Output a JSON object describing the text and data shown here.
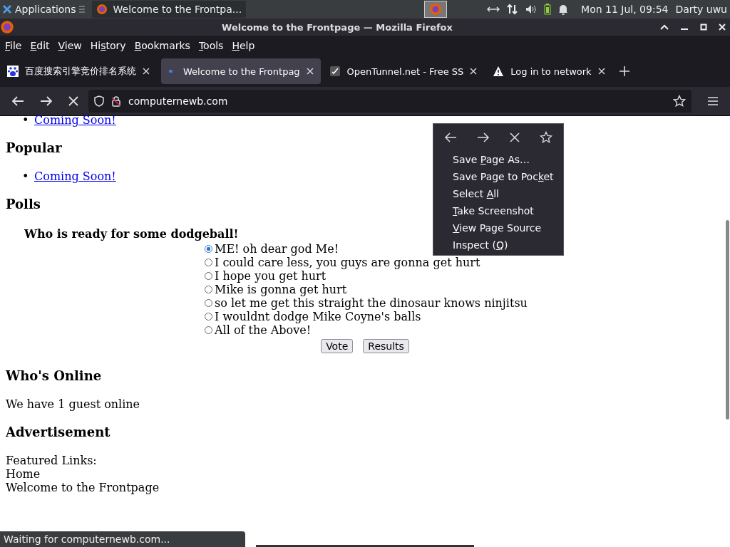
{
  "taskbar": {
    "apps_label": "Applications",
    "task": "Welcome to the Frontpa...",
    "clock": "Mon 11 Jul, 09:54",
    "user": "Darty uwu"
  },
  "window": {
    "title": "Welcome to the Frontpage — Mozilla Firefox"
  },
  "menubar": [
    {
      "key": "F",
      "after": "ile"
    },
    {
      "key": "E",
      "after": "dit"
    },
    {
      "key": "V",
      "after": "iew"
    },
    {
      "before": "Hi",
      "key": "s",
      "after": "tory"
    },
    {
      "key": "B",
      "after": "ookmarks"
    },
    {
      "key": "T",
      "after": "ools"
    },
    {
      "key": "H",
      "after": "elp"
    }
  ],
  "tabs": [
    {
      "title": "百度搜索引擎竞价排名系统",
      "kind": "paw",
      "selected": false
    },
    {
      "title": "Welcome to the Frontpag",
      "kind": "dot",
      "selected": true
    },
    {
      "title": "OpenTunnel.net - Free SS",
      "kind": "check",
      "selected": false
    },
    {
      "title": "Log in to network",
      "kind": "warning",
      "selected": false
    }
  ],
  "urlbar": {
    "url": "computernewb.com"
  },
  "page": {
    "top_links": [
      {
        "marker": "•",
        "text": "Coming Soon!"
      }
    ],
    "popular": {
      "heading": "Popular",
      "links": [
        {
          "marker": "•",
          "text": "Coming Soon!"
        }
      ]
    },
    "polls": {
      "heading": "Polls",
      "question": "Who is ready for some dodgeball!",
      "options": [
        {
          "label": "ME! oh dear god Me!",
          "selected": true
        },
        {
          "label": "I could care less, you guys are gonna get hurt",
          "selected": false
        },
        {
          "label": "I hope you get hurt",
          "selected": false
        },
        {
          "label": "Mike is gonna get hurt",
          "selected": false
        },
        {
          "label": "so let me get this straight the dinosaur knows ninjitsu",
          "selected": false
        },
        {
          "label": "I wouldnt dodge Mike Coyne's balls",
          "selected": false
        },
        {
          "label": "All of the Above!",
          "selected": false
        }
      ],
      "buttons": [
        "Vote",
        "Results"
      ]
    },
    "online": {
      "heading": "Who's Online",
      "text": "We have 1 guest online"
    },
    "ad": {
      "heading": "Advertisement",
      "lines": [
        "Featured Links:",
        "Home",
        "Welcome to the Frontpage"
      ]
    }
  },
  "context_menu": {
    "items": [
      {
        "before": "Save ",
        "key": "P",
        "after": "age As…"
      },
      {
        "before": "Save Page to Poc",
        "key": "k",
        "after": "et"
      },
      {
        "before": "Select ",
        "key": "A",
        "after": "ll"
      },
      {
        "key": "T",
        "after": "ake Screenshot"
      },
      {
        "key": "V",
        "after": "iew Page Source"
      },
      {
        "before": "Inspect (",
        "key": "Q",
        "after": ")"
      }
    ]
  },
  "status": "Waiting for computernewb.com..."
}
